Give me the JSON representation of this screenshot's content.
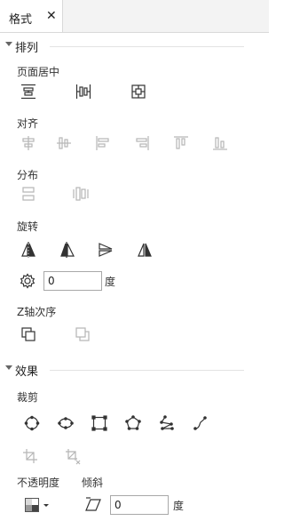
{
  "tab": {
    "label": "格式",
    "close": "✕"
  },
  "sections": {
    "arrange": {
      "title": "排列",
      "page_center_label": "页面居中",
      "align_label": "对齐",
      "distribute_label": "分布",
      "rotate_label": "旋转",
      "rotate_value": "0",
      "rotate_unit": "度",
      "zorder_label": "Z轴次序"
    },
    "effects": {
      "title": "效果",
      "crop_label": "裁剪",
      "opacity_label": "不透明度",
      "skew_label": "倾斜",
      "skew_value": "0",
      "skew_unit": "度"
    }
  },
  "colors": {
    "icon_active": "#333333",
    "icon_disabled": "#b5b5b5"
  }
}
